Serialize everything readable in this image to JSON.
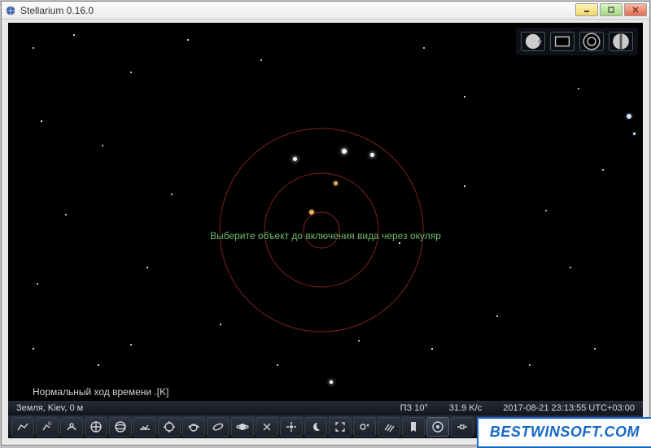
{
  "window": {
    "title": "Stellarium 0.16.0"
  },
  "top_tools": {
    "items": [
      {
        "name": "ocular-view"
      },
      {
        "name": "frame-view"
      },
      {
        "name": "telrad"
      },
      {
        "name": "config"
      }
    ]
  },
  "overlay": {
    "message": "Выберите объект до включения вида через окуляр",
    "status_line": "Нормальный ход времени .[K]"
  },
  "statusbar": {
    "location": "Земля, Kiev, 0 м",
    "direction": "ПЗ 10°",
    "fov_rate": "31.9 K/c",
    "datetime": "2017-08-21 23:13:55 UTC+03:00"
  },
  "toolbar": {
    "items": [
      "constellation-lines",
      "constellation-labels",
      "constellation-art",
      "equatorial-grid",
      "azimuthal-grid",
      "ground",
      "cardinal-points",
      "atmosphere",
      "deep-sky",
      "planet-labels",
      "equatorial-mount",
      "center-selected",
      "night-mode",
      "fullscreen",
      "exoplanets",
      "meteor-showers",
      "bookmarks",
      "ocular",
      "satellite",
      "time-rewind",
      "time-back",
      "time-play",
      "time-now",
      "time-forward",
      "quit"
    ]
  },
  "watermark": {
    "text": "BESTWINSOFT.COM"
  }
}
